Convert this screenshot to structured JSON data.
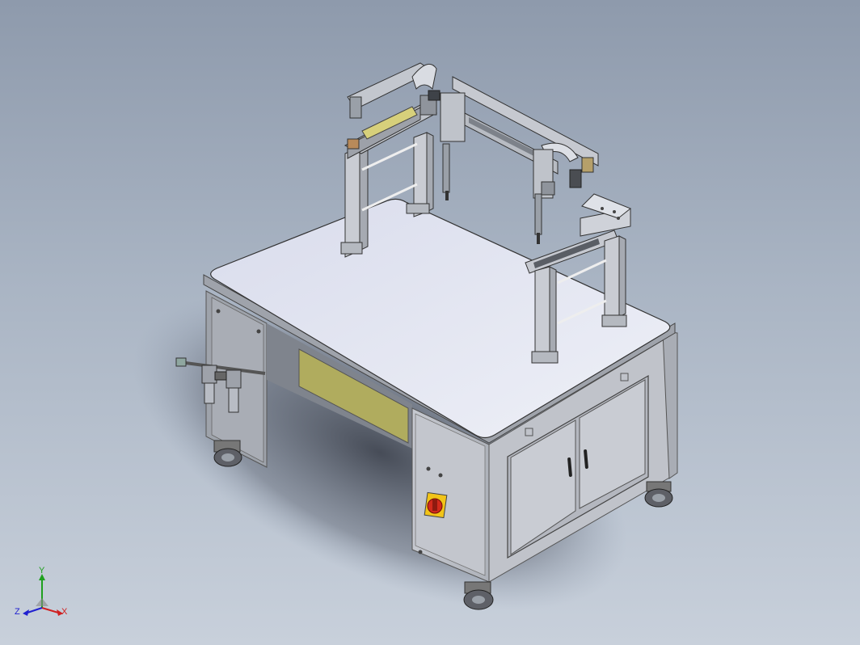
{
  "scene": {
    "subject": "cad-model-assembly",
    "colors": {
      "background_top": "#8e9aac",
      "background_bottom": "#c8d0db",
      "tabletop": "#e4e7f1",
      "cabinet": "#bfc2c9",
      "cabinet_dark": "#9ea2aa",
      "yellow_panel": "#b0ac5e",
      "frame_metal": "#d2d5db",
      "estop_red": "#d12a1c",
      "estop_yellow": "#f2c418"
    }
  },
  "triad": {
    "x_label": "X",
    "y_label": "Y",
    "z_label": "Z",
    "x_color": "#d02020",
    "y_color": "#1fa01f",
    "z_color": "#2020d0"
  }
}
